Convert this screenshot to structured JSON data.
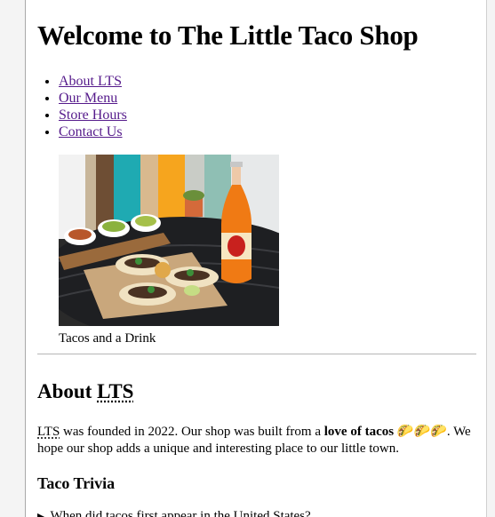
{
  "header": {
    "title": "Welcome to The Little Taco Shop"
  },
  "nav": [
    {
      "label": "About LTS"
    },
    {
      "label": "Our Menu"
    },
    {
      "label": "Store Hours"
    },
    {
      "label": "Contact Us"
    }
  ],
  "figure": {
    "caption": "Tacos and a Drink"
  },
  "about": {
    "heading_prefix": "About ",
    "heading_abbr": "LTS",
    "p_abbr": "LTS",
    "p_text1": " was founded in 2022. Our shop was built from a ",
    "p_bold": "love of tacos",
    "p_emoji": "🌮🌮🌮",
    "p_text2": ". We hope our shop adds a unique and interesting place to our little town."
  },
  "trivia": {
    "heading": "Taco Trivia",
    "question": "When did tacos first appear in the United States?"
  },
  "colors": {
    "link": "#551a8b",
    "divider": "#b5b5b5"
  }
}
